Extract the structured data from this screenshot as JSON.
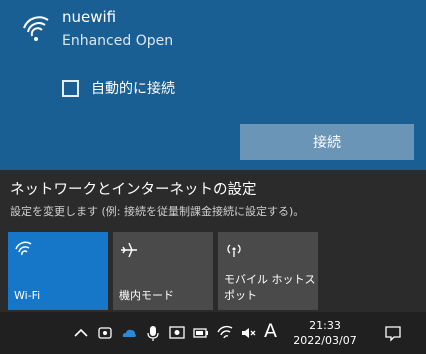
{
  "network": {
    "ssid": "nuewifi",
    "security": "Enhanced Open",
    "auto_connect_label": "自動的に接続",
    "auto_connect_checked": false,
    "connect_button": "接続"
  },
  "settings": {
    "title": "ネットワークとインターネットの設定",
    "description": "設定を変更します (例: 接続を従量制課金接続に設定する)。"
  },
  "quick_actions": [
    {
      "label": "Wi-Fi",
      "icon": "wifi-icon",
      "active": true
    },
    {
      "label": "機内モード",
      "icon": "airplane-icon",
      "active": false
    },
    {
      "label": "モバイル ホットスポット",
      "label_line1": "モバイル ホットス",
      "label_line2": "ポット",
      "icon": "hotspot-icon",
      "active": false
    }
  ],
  "taskbar": {
    "ime_label": "A",
    "time": "21:33",
    "date": "2022/03/07"
  },
  "colors": {
    "selected_network_bg": "#1a5f93",
    "connect_button_bg": "#6a95b6",
    "active_tile_bg": "#1677c9",
    "tile_bg": "#4a4a4a",
    "panel_bg": "#2b2b2b",
    "taskbar_bg": "#202020"
  }
}
